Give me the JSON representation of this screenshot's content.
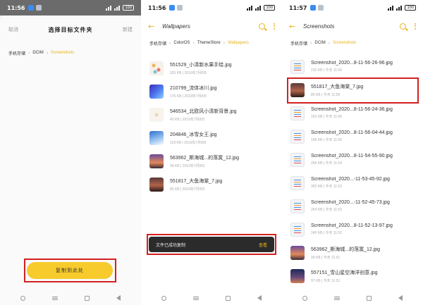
{
  "panel1": {
    "status": {
      "time": "11:56",
      "battery": "100"
    },
    "sheet": {
      "left_action": "取消",
      "title": "选择目标文件夹",
      "right_action": "新建"
    },
    "breadcrumb": [
      "手机存储",
      "DCIM",
      "Screenshots"
    ],
    "copy_button": "复制到此处"
  },
  "panel2": {
    "status": {
      "time": "11:56",
      "battery": "100"
    },
    "title": "Wallpapers",
    "breadcrumb": [
      "手机存储",
      "ColorOS",
      "ThemeStore",
      "Wallpapers"
    ],
    "files": [
      {
        "name": "551529_小清新水果手绘.jpg",
        "meta": "325 KB | 2019年7月8日",
        "thumb": "t-dots"
      },
      {
        "name": "210799_流体冰川.jpg",
        "meta": "176 KB | 2019年7月8日",
        "thumb": "t-blue"
      },
      {
        "name": "546534_北欧风小清新背景.jpg",
        "meta": "45 KB | 2019年7月8日",
        "thumb": "t-cream"
      },
      {
        "name": "204846_冰雪女王.jpg",
        "meta": "118 KB | 2019年7月8日",
        "thumb": "t-sky"
      },
      {
        "name": "563962_斯海城...的落寞_12.jpg",
        "meta": "99 KB | 2019年7月8日",
        "thumb": "t-sunset"
      },
      {
        "name": "551817_大鱼海棠_7.jpg",
        "meta": "85 KB | 2019年7月8日",
        "thumb": "t-dark"
      }
    ],
    "toast": {
      "text": "文件已成功复制",
      "action": "查看"
    }
  },
  "panel3": {
    "status": {
      "time": "11:57",
      "battery": "100"
    },
    "title": "Screenshots",
    "breadcrumb": [
      "手机存储",
      "DCIM",
      "Screenshots"
    ],
    "files": [
      {
        "name": "Screenshot_2020...8-11-56-26-96.jpg",
        "meta": "210 KB | 今天 11:56",
        "thumb": "t-doc"
      },
      {
        "name": "551817_大鱼海棠_7.jpg",
        "meta": "85 KB | 今天 11:56",
        "thumb": "t-dark"
      },
      {
        "name": "Screenshot_2020...8-11-56-24-36.jpg",
        "meta": "162 KB | 今天 11:56",
        "thumb": "t-doc"
      },
      {
        "name": "Screenshot_2020...8-11-56-04-44.jpg",
        "meta": "168 KB | 今天 11:56",
        "thumb": "t-doc"
      },
      {
        "name": "Screenshot_2020...8-11-54-55-90.jpg",
        "meta": "206 KB | 今天 11:54",
        "thumb": "t-doc"
      },
      {
        "name": "Screenshot_2020...-11-53-45-92.jpg",
        "meta": "302 KB | 今天 11:53",
        "thumb": "t-doc"
      },
      {
        "name": "Screenshot_2020...-11-52-45-73.jpg",
        "meta": "254 KB | 今天 11:52",
        "thumb": "t-doc"
      },
      {
        "name": "Screenshot_2020...8-11-52-13-97.jpg",
        "meta": "240 KB | 今天 11:52",
        "thumb": "t-doc"
      },
      {
        "name": "563962_斯海城...的落寞_12.jpg",
        "meta": "99 KB | 今天 11:51",
        "thumb": "t-sunset"
      },
      {
        "name": "557151_雪山星空海洋创意.jpg",
        "meta": "97 KB | 今天 11:51",
        "thumb": "t-night"
      }
    ]
  }
}
